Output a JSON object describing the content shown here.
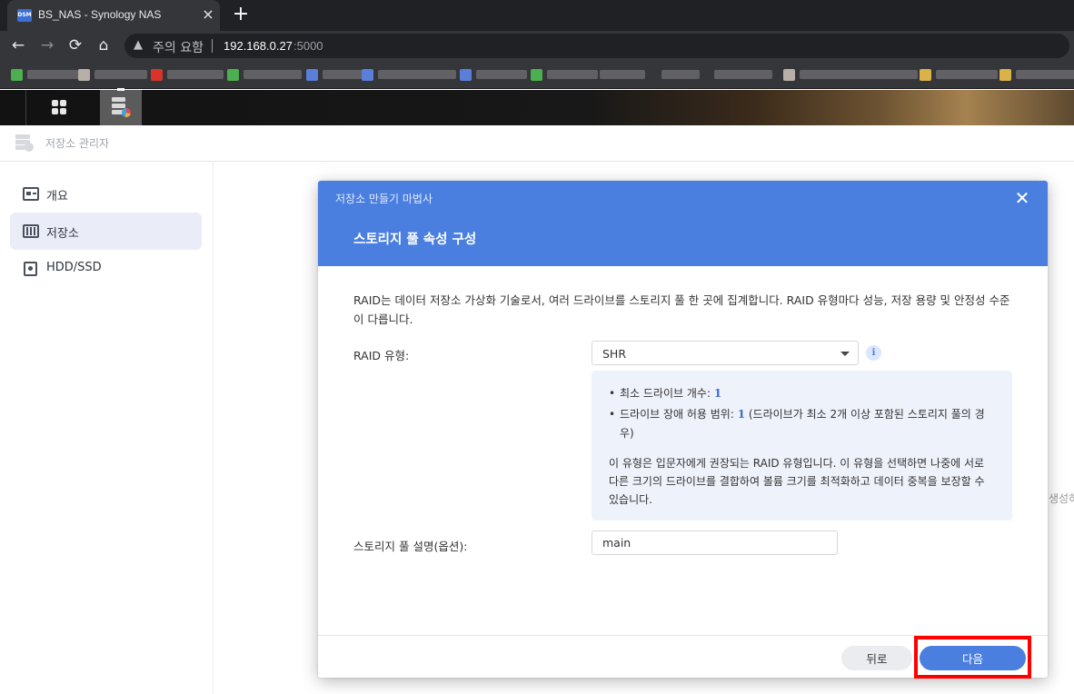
{
  "browser": {
    "tab_title": "BS_NAS - Synology NAS",
    "favicon_text": "DSM",
    "security_label": "주의 요함",
    "url_host": "192.168.0.27",
    "url_port": ":5000",
    "icons": {
      "close": "×",
      "new_tab": "+",
      "back": "←",
      "forward": "→",
      "reload": "⟳",
      "home": "⌂",
      "warning": "▲"
    }
  },
  "app": {
    "title": "저장소 관리자"
  },
  "sidebar": {
    "items": [
      {
        "label": "개요",
        "icon": "overview-icon",
        "active": false
      },
      {
        "label": "저장소",
        "icon": "storage-icon",
        "active": true
      },
      {
        "label": "HDD/SSD",
        "icon": "hdd-icon",
        "active": false
      }
    ]
  },
  "background": {
    "edge_text": "생성하"
  },
  "wizard": {
    "window_title": "저장소 만들기 마법사",
    "close_glyph": "✕",
    "step_title": "스토리지 풀 속성 구성",
    "intro": "RAID는 데이터 저장소 가상화 기술로서, 여러 드라이브를 스토리지 풀 한 곳에 집계합니다. RAID 유형마다 성능, 저장 용량 및 안정성 수준이 다릅니다.",
    "raid_label": "RAID 유형:",
    "raid_value": "SHR",
    "info_glyph": "i",
    "info": {
      "bullet_glyph": "•",
      "min_drives_label": "최소 드라이브 개수: ",
      "min_drives_value": "1",
      "fault_tolerance_label": "드라이브 장애 허용 범위: ",
      "fault_tolerance_value": "1",
      "fault_tolerance_note": " (드라이브가 최소 2개 이상 포함된 스토리지 풀의 경우)",
      "description": "이 유형은 입문자에게 권장되는 RAID 유형입니다. 이 유형을 선택하면 나중에 서로 다른 크기의 드라이브를 결합하여 볼륨 크기를 최적화하고 데이터 중복을 보장할 수 있습니다."
    },
    "pool_desc_label": "스토리지 풀 설명(옵션):",
    "pool_desc_value": "main",
    "back_button": "뒤로",
    "next_button": "다음"
  },
  "colors": {
    "accent": "#4a7fe0",
    "highlight": "#ff0000",
    "sidebar_active": "#eaedf8"
  }
}
